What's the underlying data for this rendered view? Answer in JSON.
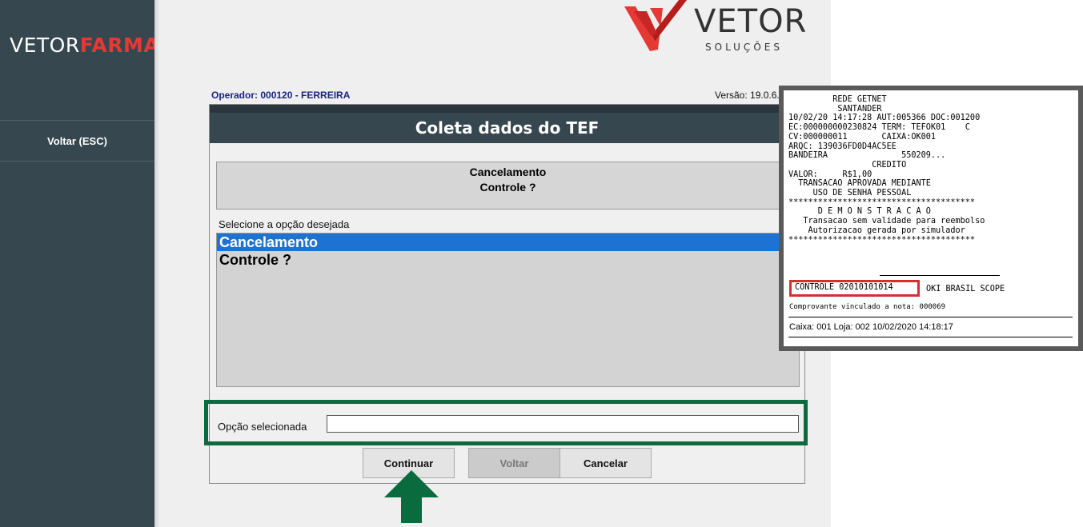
{
  "sidebar": {
    "brand_part1": "VETOR",
    "brand_part2": "FARMA",
    "back_button": "Voltar (ESC)"
  },
  "logo": {
    "word": "VETOR",
    "sub": "SOLUÇÕES"
  },
  "header": {
    "operator": "Operador: 000120 - FERREIRA",
    "version": "Versão: 19.0.6."
  },
  "dialog": {
    "title": "Coleta dados do TEF",
    "prompt_line1": "Cancelamento",
    "prompt_line2": "Controle ?",
    "select_label": "Selecione a opção desejada",
    "options": [
      "Cancelamento",
      "Controle ?"
    ],
    "selected_option": "Cancelamento",
    "selected_field_label": "Opção selecionada",
    "selected_field_value": "",
    "buttons": {
      "continue": "Continuar",
      "back": "Voltar",
      "cancel": "Cancelar"
    }
  },
  "receipt": {
    "lines": [
      "         REDE GETNET",
      "          SANTANDER",
      "10/02/20 14:17:28 AUT:005366 DOC:001200",
      "EC:000000000230824 TERM: TEFOK01    C",
      "CV:000000011       CAIXA:OK001",
      "ARQC: 139036FD0D4AC5EE",
      "BANDEIRA               550209...",
      "                 CREDITO",
      "VALOR:     R$1,00",
      "  TRANSACAO APROVADA MEDIANTE",
      "     USO DE SENHA PESSOAL",
      "**************************************",
      "      D E M O N S T R A C A O",
      "   Transacao sem validade para reembolso",
      "    Autorizacao gerada por simulador",
      "**************************************"
    ],
    "control_code": "CONTROLE 02010101014",
    "control_rest": "OKI BRASIL SCOPE",
    "linked_note": "Comprovante vinculado a nota: 000069",
    "footer": "Caixa: 001 Loja: 002 10/02/2020 14:18:17"
  },
  "colors": {
    "sidebar": "#37474f",
    "brand_accent": "#e53935",
    "selection": "#1e73d2",
    "highlight": "#0a6b3e",
    "control_box": "#d32f2f"
  }
}
